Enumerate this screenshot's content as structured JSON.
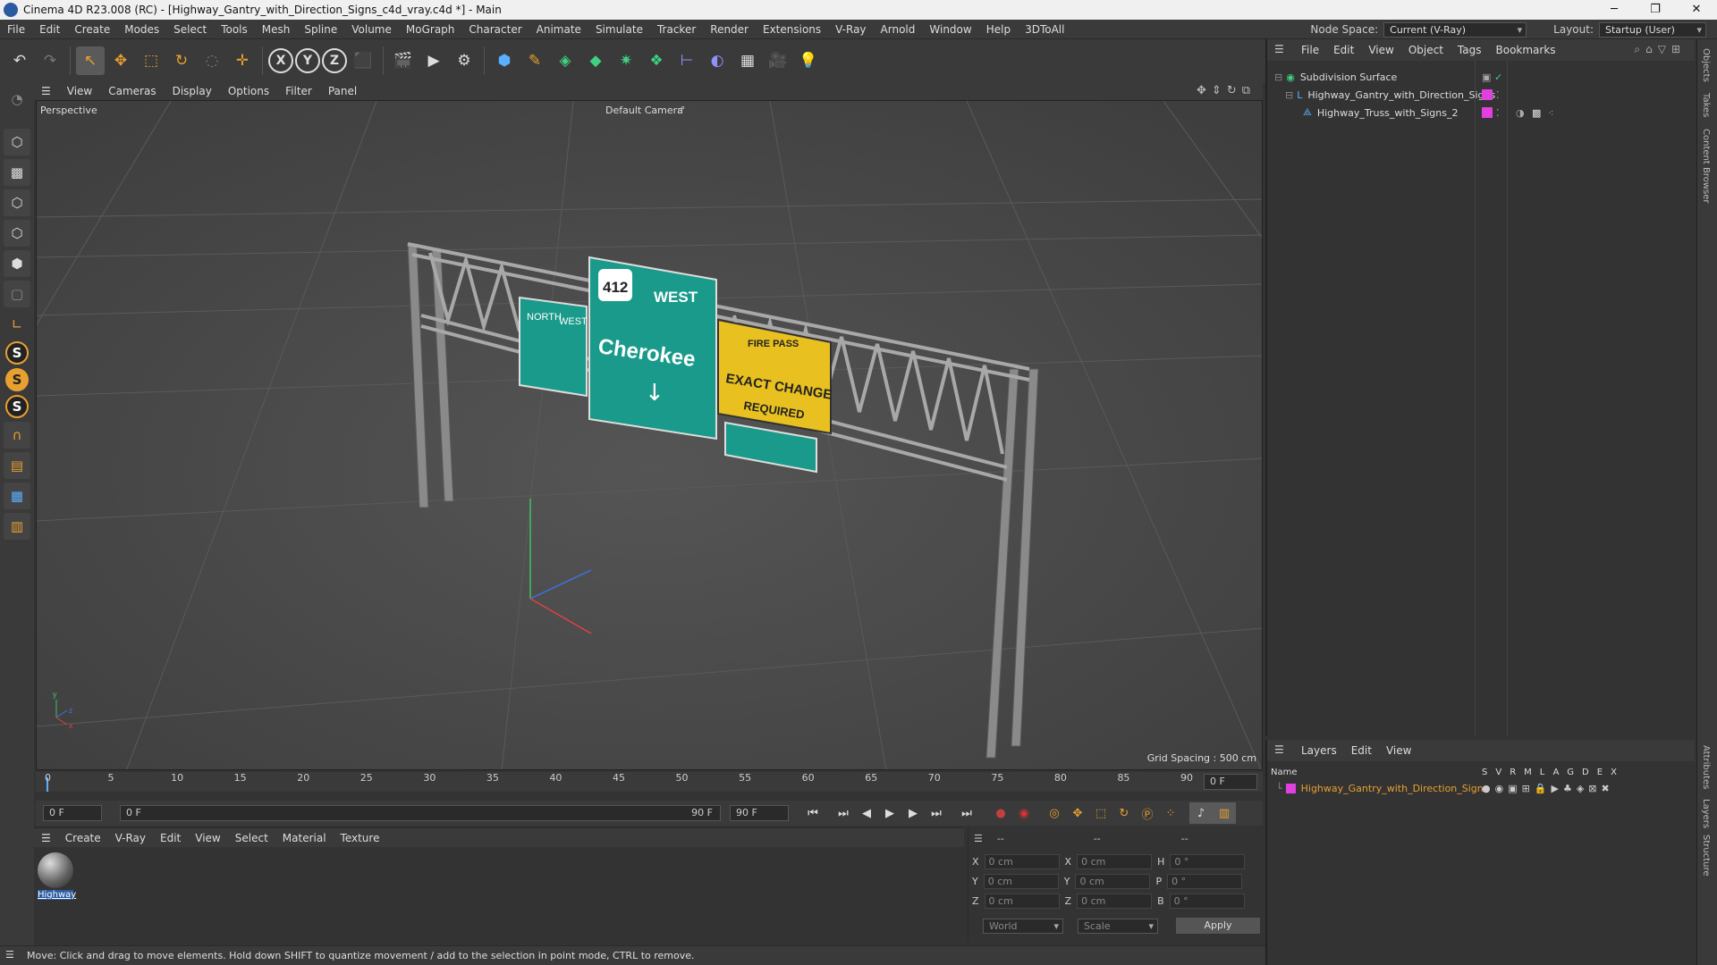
{
  "window": {
    "title": "Cinema 4D R23.008 (RC) - [Highway_Gantry_with_Direction_Signs_c4d_vray.c4d *] - Main",
    "minimize": "─",
    "maximize": "❐",
    "close": "✕"
  },
  "menu": [
    "File",
    "Edit",
    "Create",
    "Modes",
    "Select",
    "Tools",
    "Mesh",
    "Spline",
    "Volume",
    "MoGraph",
    "Character",
    "Animate",
    "Simulate",
    "Tracker",
    "Render",
    "Extensions",
    "V-Ray",
    "Arnold",
    "Window",
    "Help",
    "3DToAll"
  ],
  "node_space": {
    "label": "Node Space:",
    "value": "Current (V-Ray)"
  },
  "layout": {
    "label": "Layout:",
    "value": "Startup (User)"
  },
  "toolbar": {
    "undo": "↶",
    "redo": "↷",
    "select": "↖",
    "move": "✥",
    "scale": "⬚",
    "rotate": "↻",
    "x": "X",
    "y": "Y",
    "z": "Z"
  },
  "viewport_menu": [
    "View",
    "Cameras",
    "Display",
    "Options",
    "Filter",
    "Panel"
  ],
  "viewport": {
    "name": "Perspective",
    "camera": "Default Camera",
    "camera_mark": ":°",
    "grid_spacing": "Grid Spacing : 500 cm",
    "axis_y": "y",
    "axis_z": "z",
    "axis_x": "x"
  },
  "signs": {
    "route": "412",
    "west": "WEST",
    "cherokee": "Cherokee",
    "north": "NORTH",
    "west2": "WEST",
    "yellow1": "FIRE PASS",
    "yellow2": "EXACT CHANGE",
    "yellow3": "REQUIRED"
  },
  "timeline": {
    "ticks": [
      "0",
      "5",
      "10",
      "15",
      "20",
      "25",
      "30",
      "35",
      "40",
      "45",
      "50",
      "55",
      "60",
      "65",
      "70",
      "75",
      "80",
      "85",
      "90"
    ],
    "end_field": "0 F"
  },
  "playback": {
    "start": "0 F",
    "range_start": "0 F",
    "range_end": "90 F",
    "end": "90 F"
  },
  "material_menu": [
    "Create",
    "V-Ray",
    "Edit",
    "View",
    "Select",
    "Material",
    "Texture"
  ],
  "material": {
    "name": "Highway"
  },
  "coords": {
    "headers": [
      "--",
      "--",
      "--"
    ],
    "rows": [
      {
        "a": "X",
        "v1": "0 cm",
        "b": "X",
        "v2": "0 cm",
        "c": "H",
        "v3": "0 °"
      },
      {
        "a": "Y",
        "v1": "0 cm",
        "b": "Y",
        "v2": "0 cm",
        "c": "P",
        "v3": "0 °"
      },
      {
        "a": "Z",
        "v1": "0 cm",
        "b": "Z",
        "v2": "0 cm",
        "c": "B",
        "v3": "0 °"
      }
    ],
    "world": "World",
    "scale": "Scale",
    "apply": "Apply"
  },
  "status": "Move: Click and drag to move elements. Hold down SHIFT to quantize movement / add to the selection in point mode, CTRL to remove.",
  "objects_menu": [
    "File",
    "Edit",
    "View",
    "Object",
    "Tags",
    "Bookmarks"
  ],
  "objects": [
    {
      "name": "Subdivision Surface"
    },
    {
      "name": "Highway_Gantry_with_Direction_Signs"
    },
    {
      "name": "Highway_Truss_with_Signs_2"
    }
  ],
  "layers_menu": [
    "Layers",
    "Edit",
    "View"
  ],
  "layers": {
    "name_header": "Name",
    "cols": [
      "S",
      "V",
      "R",
      "M",
      "L",
      "A",
      "G",
      "D",
      "E",
      "X"
    ],
    "row": "Highway_Gantry_with_Direction_Signs"
  },
  "side_tabs": [
    "Objects",
    "Takes",
    "Content Browser",
    "Attributes",
    "Layers",
    "Structure"
  ],
  "colors": {
    "accent": "#e8a030",
    "layer_color": "#e040e0",
    "selected_text": "#e8a030",
    "sign_green": "#1a9a8a",
    "sign_yellow": "#e8c020"
  }
}
